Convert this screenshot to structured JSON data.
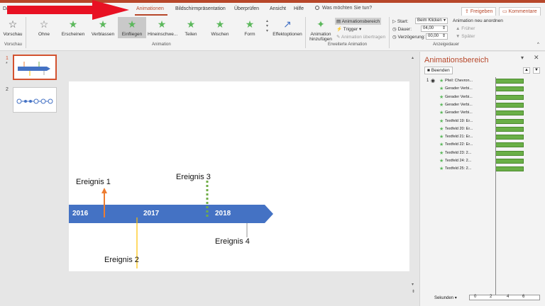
{
  "tabs": [
    {
      "label": "Dat",
      "active": false
    },
    {
      "label": "Animationen",
      "active": true
    },
    {
      "label": "Bildschirmpräsentation",
      "active": false
    },
    {
      "label": "Überprüfen",
      "active": false
    },
    {
      "label": "Ansicht",
      "active": false
    },
    {
      "label": "Hilfe",
      "active": false
    }
  ],
  "tell_me": "Was möchten Sie tun?",
  "share_label": "Freigeben",
  "comment_label": "Kommentare",
  "ribbon": {
    "preview_label": "Vorschau",
    "preview_group": "Vorschau",
    "animations": [
      "Ohne",
      "Erscheinen",
      "Verblassen",
      "Einfliegen",
      "Hineinschwe...",
      "Teilen",
      "Wischen",
      "Form"
    ],
    "selected_animation": "Einfliegen",
    "effect_options": "Effektoptionen",
    "animation_group": "Animation",
    "add_animation": "Animation hinzufügen",
    "animation_pane_btn": "Animationsbereich",
    "trigger": "Trigger",
    "animation_painter": "Animation übertragen",
    "advanced_group": "Erweiterte Animation",
    "start_label": "Start:",
    "start_value": "Beim Klicken",
    "duration_label": "Dauer:",
    "duration_value": "04,00",
    "delay_label": "Verzögerung:",
    "delay_value": "00,00",
    "reorder_label": "Animation neu anordnen",
    "earlier": "Früher",
    "later": "Später",
    "timing_group": "Anzeigedauer"
  },
  "slides": [
    {
      "number": "1",
      "star": "*"
    },
    {
      "number": "2",
      "star": ""
    }
  ],
  "slide": {
    "years": [
      "2016",
      "2017",
      "2018"
    ],
    "events": [
      "Ereignis 1",
      "Ereignis 2",
      "Ereignis 3",
      "Ereignis 4"
    ]
  },
  "anim_pane": {
    "title": "Animationsbereich",
    "play_btn": "Beenden",
    "first_index": "1",
    "items": [
      "Pfeil: Chevron...",
      "Gerader Verbi...",
      "Gerader Verbi...",
      "Gerader Verbi...",
      "Gerader Verbi...",
      "Textfeld 19: Er...",
      "Textfeld 20: Er...",
      "Textfeld 21: Er...",
      "Textfeld 22: Er...",
      "Textfeld 23: 2...",
      "Textfeld 24: 2...",
      "Textfeld 25: 2..."
    ],
    "seconds_label": "Sekunden",
    "ticks": [
      "0",
      "2",
      "4",
      "6"
    ]
  },
  "colors": {
    "accent": "#b7472a",
    "timeline": "#4472c4",
    "event1": "#ed7d31",
    "event2": "#ffc000",
    "event3": "#70ad47",
    "event4": "#a5a5a5",
    "arrow": "#e81123"
  }
}
